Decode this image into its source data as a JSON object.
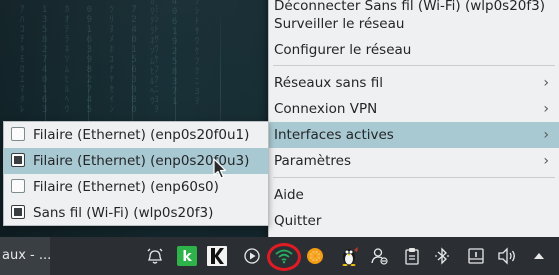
{
  "main_menu": {
    "items": [
      {
        "label": "Déconnecter Sans fil (Wi-Fi) (wlp0s20f3)",
        "has_submenu": false
      },
      {
        "label": "Surveiller le réseau",
        "has_submenu": false
      },
      {
        "label": "Configurer le réseau",
        "has_submenu": false
      },
      {
        "label": "Réseaux sans fil",
        "has_submenu": true,
        "arrow": "›"
      },
      {
        "label": "Connexion VPN",
        "has_submenu": true,
        "arrow": "›"
      },
      {
        "label": "Interfaces actives",
        "has_submenu": true,
        "arrow": "›",
        "active": true
      },
      {
        "label": "Paramètres",
        "has_submenu": true,
        "arrow": "›"
      },
      {
        "label": "Aide",
        "has_submenu": false
      },
      {
        "label": "Quitter",
        "has_submenu": false
      }
    ]
  },
  "submenu": {
    "items": [
      {
        "label": "Filaire (Ethernet) (enp0s20f0u1)",
        "checked": false
      },
      {
        "label": "Filaire (Ethernet) (enp0s20f0u3)",
        "checked": true,
        "active": true
      },
      {
        "label": "Filaire (Ethernet) (enp60s0)",
        "checked": false
      },
      {
        "label": "Sans fil (Wi-Fi) (wlp0s20f3)",
        "checked": true
      }
    ]
  },
  "taskbar": {
    "window_title": "aux - ...",
    "tray_icons": [
      "alarm-clock-icon",
      "k-green-app-icon",
      "k-black-app-icon",
      "play-circle-icon",
      "wifi-icon",
      "orange-icon",
      "tux-penguin-icon",
      "user-status-icon",
      "clipboard-icon",
      "bluetooth-icon",
      "notifications-icon",
      "volume-icon",
      "expand-tray-icon"
    ]
  },
  "colors": {
    "menu_bg": "#eff0f1",
    "highlight": "#a9c9d2",
    "taskbar_bg": "#2b2f33",
    "wifi_green": "#27ae60",
    "annotation_red": "#e01b24"
  }
}
